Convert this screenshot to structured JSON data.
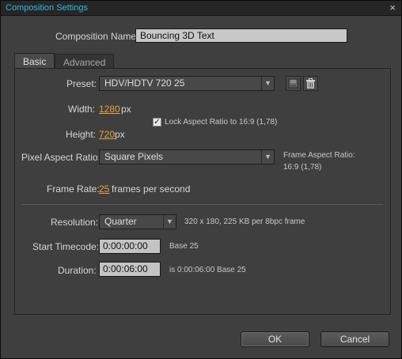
{
  "window": {
    "title": "Composition Settings",
    "close_glyph": "×"
  },
  "composition_name": {
    "label": "Composition Name:",
    "value": "Bouncing 3D Text"
  },
  "tabs": [
    {
      "label": "Basic"
    },
    {
      "label": "Advanced"
    }
  ],
  "preset": {
    "label": "Preset:",
    "value": "HDV/HDTV 720 25"
  },
  "width": {
    "label": "Width:",
    "value": "1280",
    "unit": "px"
  },
  "height": {
    "label": "Height:",
    "value": "720",
    "unit": "px"
  },
  "lock_aspect": {
    "label": "Lock Aspect Ratio to 16:9 (1,78)",
    "checked": true
  },
  "pixel_aspect": {
    "label": "Pixel Aspect Ratio:",
    "value": "Square Pixels"
  },
  "frame_aspect": {
    "label": "Frame Aspect Ratio:",
    "value": "16:9 (1,78)"
  },
  "frame_rate": {
    "label": "Frame Rate:",
    "value": "25",
    "unit": "frames per second"
  },
  "resolution": {
    "label": "Resolution:",
    "value": "Quarter",
    "info": "320 x 180, 225 KB per 8bpc frame"
  },
  "start_timecode": {
    "label": "Start Timecode:",
    "value": "0:00:00:00",
    "base": "Base 25"
  },
  "duration": {
    "label": "Duration:",
    "value": "0:00:06:00",
    "info": "is 0:00:06:00  Base 25"
  },
  "buttons": {
    "ok": "OK",
    "cancel": "Cancel"
  },
  "icons": {
    "save_preset": "save-icon",
    "delete_preset": "trash-icon",
    "dropdown_arrow": "▼"
  },
  "colors": {
    "title_accent": "#33b5e5",
    "value_accent": "#e8a33d"
  }
}
